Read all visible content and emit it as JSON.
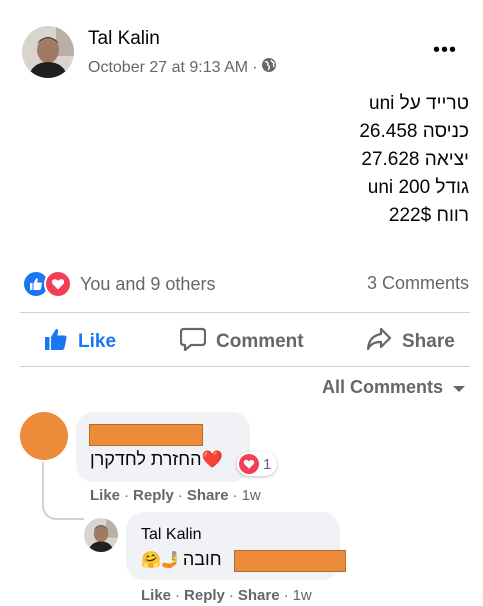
{
  "post": {
    "author": "Tal Kalin",
    "timestamp": "October 27 at 9:13 AM",
    "separator": "·",
    "visibility_icon": "globe-icon",
    "more_label": "•••",
    "lines": [
      "טרייד על uni",
      "כניסה 26.458",
      "יציאה 27.628",
      "גודל 200 uni",
      "רווח 222$"
    ]
  },
  "reactions": {
    "types": [
      "like",
      "love"
    ],
    "summary": "You and 9 others",
    "comments_count": "3 Comments"
  },
  "actions": {
    "like": "Like",
    "comment": "Comment",
    "share": "Share"
  },
  "filter": {
    "label": "All Comments"
  },
  "comments": [
    {
      "author_redacted": true,
      "text": "החזרת לחדקרן",
      "emoji": "❤️",
      "reaction_count": "1",
      "like": "Like",
      "reply": "Reply",
      "share": "Share",
      "age": "1w",
      "dot": "·"
    }
  ],
  "reply": {
    "author": "Tal Kalin",
    "text": "חובה",
    "emoji": "🤗🤳",
    "like": "Like",
    "reply": "Reply",
    "share": "Share",
    "age": "1w",
    "dot": "·"
  },
  "colors": {
    "accent": "#1877f2",
    "love": "#f33e58",
    "redaction": "#ec8b3a",
    "muted": "#65676b",
    "bubble": "#f0f2f5"
  }
}
